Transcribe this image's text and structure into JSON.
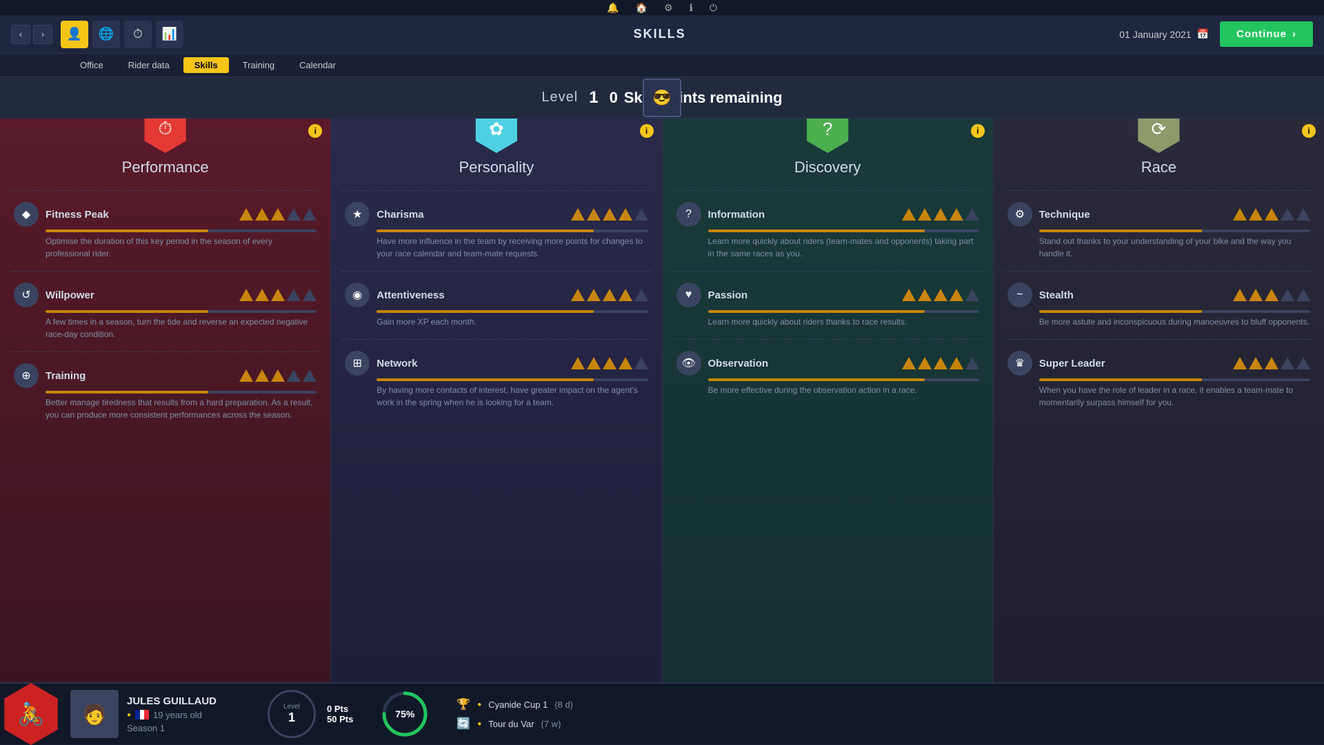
{
  "topbar": {
    "icons": [
      "🔔",
      "🏠",
      "⚙",
      "ℹ",
      "⏻"
    ]
  },
  "navbar": {
    "title": "SKILLS",
    "date": "01 January 2021",
    "continue_label": "Continue"
  },
  "subtabs": {
    "tabs": [
      "Office",
      "Rider data",
      "Skills",
      "Training",
      "Calendar"
    ],
    "active": "Skills"
  },
  "levelbar": {
    "level_label": "Level",
    "level_value": "1",
    "skill_points_value": "0",
    "skill_points_label": "Skill Points remaining"
  },
  "cards": [
    {
      "id": "performance",
      "title": "Performance",
      "hex_color": "red",
      "hex_icon": "⏱",
      "bg_class": "card-performance",
      "skills": [
        {
          "name": "Fitness Peak",
          "icon": "◆",
          "bars": [
            3,
            5
          ],
          "progress": 60,
          "desc": "Optimise the duration of this key period in the season of every professional rider."
        },
        {
          "name": "Willpower",
          "icon": "↺",
          "bars": [
            3,
            5
          ],
          "progress": 60,
          "desc": "A few times in a season, turn the tide and reverse an expected negative race-day condition."
        },
        {
          "name": "Training",
          "icon": "⊕",
          "bars": [
            3,
            5
          ],
          "progress": 60,
          "desc": "Better manage tiredness that results from a hard preparation. As a result, you can produce more consistent performances across the season."
        }
      ]
    },
    {
      "id": "personality",
      "title": "Personality",
      "hex_color": "cyan",
      "hex_icon": "✿",
      "bg_class": "card-personality",
      "skills": [
        {
          "name": "Charisma",
          "icon": "★",
          "bars": [
            4,
            5
          ],
          "progress": 80,
          "desc": "Have more influence in the team by receiving more points for changes to your race calendar and team-mate requests."
        },
        {
          "name": "Attentiveness",
          "icon": "◉",
          "bars": [
            4,
            5
          ],
          "progress": 80,
          "desc": "Gain more XP each month."
        },
        {
          "name": "Network",
          "icon": "⊞",
          "bars": [
            4,
            5
          ],
          "progress": 80,
          "desc": "By having more contacts of interest, have greater impact on the agent's work in the spring when he is looking for a team."
        }
      ]
    },
    {
      "id": "discovery",
      "title": "Discovery",
      "hex_color": "green",
      "hex_icon": "?",
      "bg_class": "card-discovery",
      "skills": [
        {
          "name": "Information",
          "icon": "?",
          "bars": [
            4,
            5
          ],
          "progress": 80,
          "desc": "Learn more quickly about riders (team-mates and opponents) taking part in the same races as you."
        },
        {
          "name": "Passion",
          "icon": "♥",
          "bars": [
            4,
            5
          ],
          "progress": 80,
          "desc": "Learn more quickly about riders thanks to race results."
        },
        {
          "name": "Observation",
          "icon": "👁",
          "bars": [
            4,
            5
          ],
          "progress": 80,
          "desc": "Be more effective during the observation action in a race."
        }
      ]
    },
    {
      "id": "race",
      "title": "Race",
      "hex_color": "tan",
      "hex_icon": "⟳",
      "bg_class": "card-race",
      "skills": [
        {
          "name": "Technique",
          "icon": "⚙",
          "bars": [
            3,
            5
          ],
          "progress": 60,
          "desc": "Stand out thanks to your understanding of your bike and the way you handle it."
        },
        {
          "name": "Stealth",
          "icon": "~",
          "bars": [
            3,
            5
          ],
          "progress": 60,
          "desc": "Be more astute and inconspicuous during manoeuvres to bluff opponents."
        },
        {
          "name": "Super Leader",
          "icon": "♛",
          "bars": [
            3,
            5
          ],
          "progress": 60,
          "desc": "When you have the role of leader in a race, it enables a team-mate to momentarily surpass himself for you."
        }
      ]
    }
  ],
  "bottombar": {
    "rider_name": "JULES GUILLAUD",
    "rider_age": "19 years old",
    "rider_season": "Season 1",
    "level_label": "Level",
    "level_value": "1",
    "pts_current": "0 Pts",
    "pts_total": "50 Pts",
    "progress_pct": 75,
    "events": [
      {
        "icon": "🏆",
        "name": "Cyanide Cup 1",
        "detail": "(8 d)"
      },
      {
        "icon": "🔄",
        "name": "Tour du Var",
        "detail": "(7 w)"
      }
    ]
  }
}
